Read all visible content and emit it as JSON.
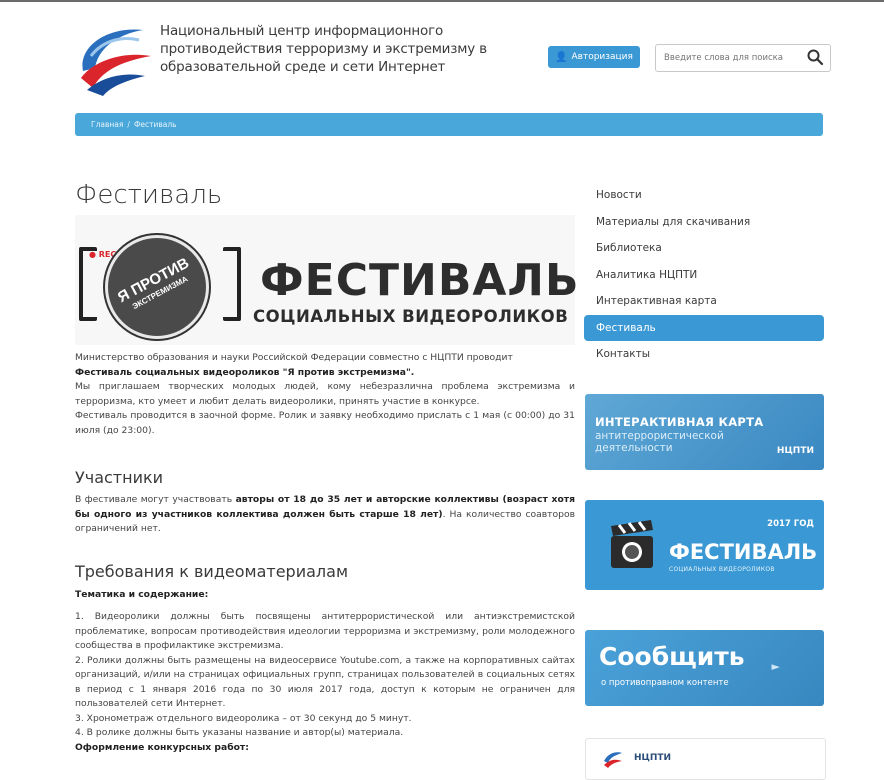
{
  "header": {
    "title": "Национальный центр информационного противодействия терроризму и экстремизму в образовательной среде и сети Интернет",
    "login_label": "Авторизация",
    "search_placeholder": "Введите слова для поиска"
  },
  "breadcrumb": {
    "home": "Главная",
    "separator": "/",
    "current": "Фестиваль"
  },
  "main": {
    "page_title": "Фестиваль",
    "banner": {
      "rec": "● REC",
      "circle_line1": "Я ПРОТИВ",
      "circle_line2": "ЭКСТРЕМИЗМА",
      "big": "ФЕСТИВАЛЬ",
      "sub": "СОЦИАЛЬНЫХ ВИДЕОРОЛИКОВ"
    },
    "intro_1": "Министерство образования и науки Российской Федерации совместно с НЦПТИ проводит",
    "intro_bold": "Фестиваль социальных видеороликов \"Я против экстремизма\".",
    "intro_2": "Мы приглашаем творческих молодых людей, кому небезразлична проблема экстремизма и терроризма, кто умеет и любит делать видеоролики, принять участие в конкурсе.",
    "intro_3": "Фестиваль проводится в заочной форме. Ролик и заявку необходимо прислать с 1 мая (с 00:00) до 31 июля (до 23:00).",
    "participants_heading": "Участники",
    "participants_1": "В фестивале могут участвовать ",
    "participants_bold": "авторы от 18 до 35 лет и авторские коллективы (возраст хотя бы одного из участников коллектива должен быть старше 18 лет)",
    "participants_2": ". На количество соавторов ограничений нет.",
    "requirements_heading": "Требования к видеоматериалам",
    "theme_heading": "Тематика и содержание:",
    "req_1": "1. Видеоролики должны быть посвящены антитеррористической или антиэкстремистской проблематике, вопросам противодействия идеологии терроризма и экстремизму, роли молодежного сообщества в профилактике экстремизма.",
    "req_2": "2. Ролики должны быть размещены на видеосервисе Youtube.com, а также на корпоративных сайтах организаций, и/или на страницах официальных групп, страницах пользователей в социальных сетях в период с 1 января 2016 года по 30 июля 2017 года, доступ к которым не ограничен для пользователей сети Интернет.",
    "req_3": "3. Хронометраж отдельного видеоролика – от 30 секунд до 5 минут.",
    "req_4": "4. В ролике должны быть указаны название и автор(ы) материала.",
    "design_heading": "Оформление конкурсных работ:"
  },
  "sidebar": {
    "items": [
      {
        "label": "Новости"
      },
      {
        "label": "Материалы для скачивания"
      },
      {
        "label": "Библиотека"
      },
      {
        "label": "Аналитика НЦПТИ"
      },
      {
        "label": "Интерактивная карта"
      },
      {
        "label": "Фестиваль"
      },
      {
        "label": "Контакты"
      }
    ],
    "active_index": 5,
    "promo_map": {
      "title": "ИНТЕРАКТИВНАЯ КАРТА",
      "sub1": "антитеррористической",
      "sub2": "деятельности",
      "brand": "НЦПТИ"
    },
    "promo_festival": {
      "year": "2017 ГОД",
      "title": "ФЕСТИВАЛЬ",
      "sub": "СОЦИАЛЬНЫХ ВИДЕОРОЛИКОВ"
    },
    "promo_report": {
      "title": "Сообщить",
      "sub": "о противоправном контенте"
    },
    "promo_logo": {
      "brand": "НЦПТИ"
    }
  },
  "colors": {
    "accent": "#3a98d4",
    "breadcrumb": "#49a7d9",
    "rec": "#d9252b"
  }
}
